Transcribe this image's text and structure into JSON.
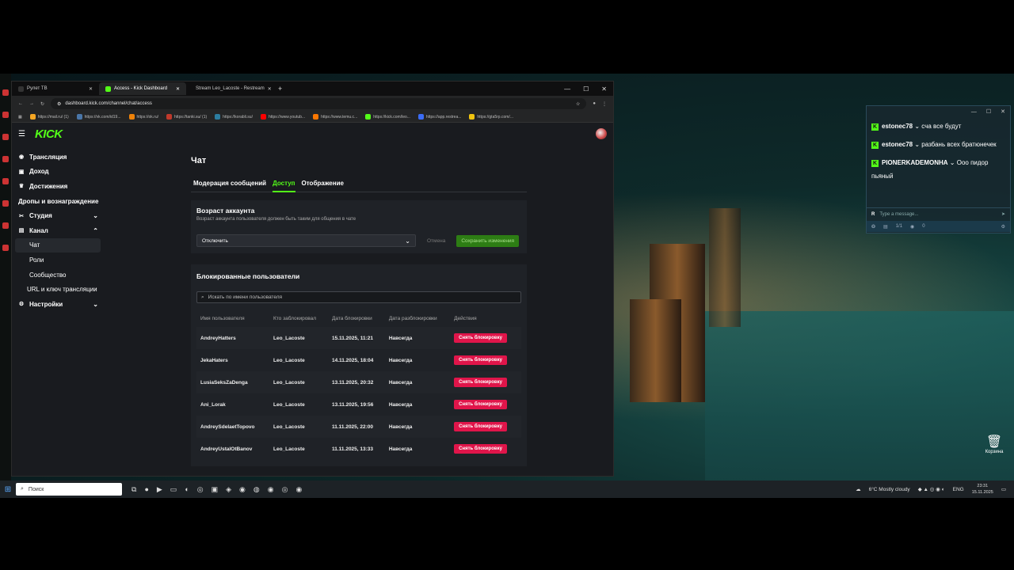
{
  "browser": {
    "tabs": [
      {
        "label": "Рулет ТВ",
        "active": false
      },
      {
        "label": "Access - Kick Dashboard",
        "active": true
      },
      {
        "label": "Stream Leo_Lacoste - Restream",
        "active": false
      }
    ],
    "url": "dashboard.kick.com/channel/chat/access",
    "bookmarks": [
      "https://mail.ru/ (1)",
      "https://vk.com/id19...",
      "https://ok.ru/",
      "https://tanki.su/ (1)",
      "https://korabli.su/",
      "https://www.youtub...",
      "https://www.temu.c...",
      "https://kick.com/leo...",
      "https://app.restrea...",
      "https://gta5rp.com/..."
    ]
  },
  "kick": {
    "logo": "KICK",
    "sidebar": [
      {
        "label": "Трансляция",
        "icon": "broadcast-icon",
        "sub": false,
        "chev": ""
      },
      {
        "label": "Доход",
        "icon": "income-icon",
        "sub": false,
        "chev": ""
      },
      {
        "label": "Достижения",
        "icon": "trophy-icon",
        "sub": false,
        "chev": ""
      },
      {
        "label": "Дропы и вознаграждение",
        "icon": "",
        "sub": false,
        "chev": ""
      },
      {
        "label": "Студия",
        "icon": "studio-icon",
        "sub": false,
        "chev": "v"
      },
      {
        "label": "Канал",
        "icon": "channel-icon",
        "sub": false,
        "chev": "^"
      },
      {
        "label": "Чат",
        "icon": "",
        "sub": true,
        "chev": "",
        "active": true
      },
      {
        "label": "Роли",
        "icon": "",
        "sub": true,
        "chev": ""
      },
      {
        "label": "Сообщество",
        "icon": "",
        "sub": true,
        "chev": ""
      },
      {
        "label": "URL и ключ трансляции",
        "icon": "",
        "sub": true,
        "chev": ""
      },
      {
        "label": "Настройки",
        "icon": "gear-icon",
        "sub": false,
        "chev": "v"
      }
    ],
    "page_title": "Чат",
    "tabs": [
      "Модерация сообщений",
      "Доступ",
      "Отображение"
    ],
    "active_tab": "Доступ",
    "age": {
      "title": "Возраст аккаунта",
      "desc": "Возраст аккаунта пользователя должен быть таким для общения в чате",
      "selected": "Отключить",
      "cancel": "Отмена",
      "save": "Сохранить изменения"
    },
    "blocked": {
      "title": "Блокированные пользователи",
      "search_placeholder": "Искать по имени пользователя",
      "columns": [
        "Имя пользователя",
        "Кто заблокировал",
        "Дата блокировки",
        "Дата разблокировки",
        "Действия"
      ],
      "rows": [
        [
          "AndreyHatters",
          "Leo_Lacoste",
          "15.11.2025, 11:21",
          "Навсегда"
        ],
        [
          "JekaHaters",
          "Leo_Lacoste",
          "14.11.2025, 18:04",
          "Навсегда"
        ],
        [
          "LusiaSeksZaDenga",
          "Leo_Lacoste",
          "13.11.2025, 20:32",
          "Навсегда"
        ],
        [
          "Ani_Lorak",
          "Leo_Lacoste",
          "13.11.2025, 19:56",
          "Навсегда"
        ],
        [
          "AndreySdelaetTopovo",
          "Leo_Lacoste",
          "11.11.2025, 22:00",
          "Навсегда"
        ],
        [
          "AndreyUstalOtBanov",
          "Leo_Lacoste",
          "11.11.2025, 13:33",
          "Навсегда"
        ]
      ],
      "unblock_label": "Снять блокировку"
    }
  },
  "chat": {
    "messages": [
      {
        "user": "estonec78",
        "text": "сча все будут"
      },
      {
        "user": "estonec78",
        "text": "разбань всех братюнечек"
      },
      {
        "user": "PIONERKADEMONHA",
        "text": "Ооо пидор пьяный"
      }
    ],
    "input_placeholder": "Type a message...",
    "footer_count": "1/1",
    "viewers": "0"
  },
  "desktop": {
    "trash_label": "Корзина"
  },
  "taskbar": {
    "search_placeholder": "Поиск",
    "weather": "6°C  Mostly cloudy",
    "lang": "ENG",
    "time": "23:31",
    "date": "15.11.2025"
  },
  "colors": {
    "accent": "#53fc18",
    "danger": "#e0154a"
  }
}
